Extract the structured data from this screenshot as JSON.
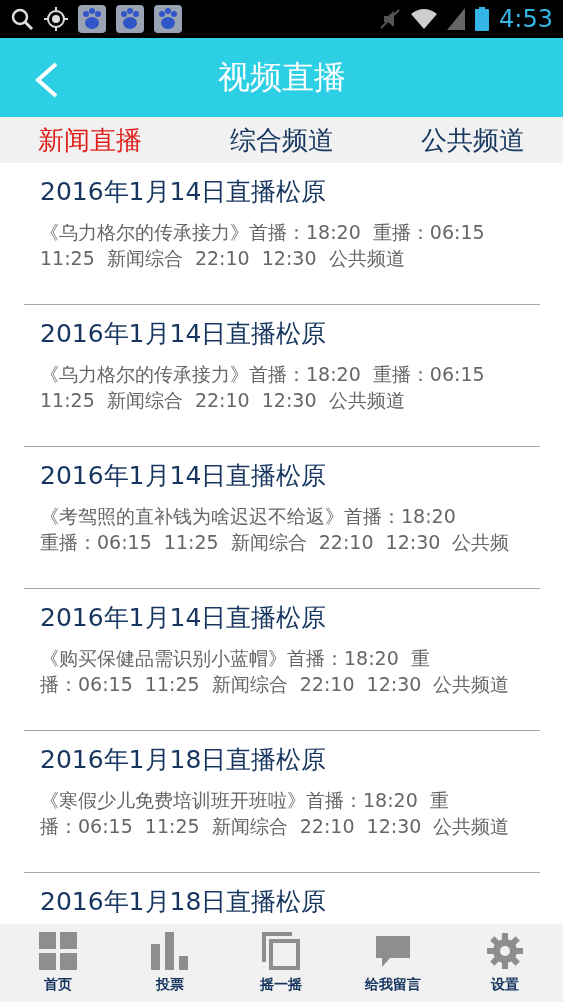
{
  "status_bar": {
    "time": "4:53"
  },
  "header": {
    "title": "视频直播"
  },
  "tabs": [
    {
      "label": "新闻直播",
      "selected": true
    },
    {
      "label": "综合频道",
      "selected": false
    },
    {
      "label": "公共频道",
      "selected": false
    }
  ],
  "items": [
    {
      "title": "2016年1月14日直播松原",
      "lines": [
        "《乌力格尔的传承接力》首播：18:20  重播：06:15",
        "11:25  新闻综合  22:10  12:30  公共频道"
      ]
    },
    {
      "title": "2016年1月14日直播松原",
      "lines": [
        "《乌力格尔的传承接力》首播：18:20  重播：06:15",
        "11:25  新闻综合  22:10  12:30  公共频道"
      ]
    },
    {
      "title": "2016年1月14日直播松原",
      "lines": [
        "《考驾照的直补钱为啥迟迟不给返》首播：18:20",
        "重播：06:15  11:25  新闻综合  22:10  12:30  公共频"
      ]
    },
    {
      "title": "2016年1月14日直播松原",
      "lines": [
        "《购买保健品需识别小蓝帽》首播：18:20  重",
        "播：06:15  11:25  新闻综合  22:10  12:30  公共频道"
      ]
    },
    {
      "title": "2016年1月18日直播松原",
      "lines": [
        "《寒假少儿免费培训班开班啦》首播：18:20  重",
        "播：06:15  11:25  新闻综合  22:10  12:30  公共频道"
      ]
    },
    {
      "title": "2016年1月18日直播松原"
    }
  ],
  "bottom_nav": [
    {
      "kind": "grid",
      "label": "首页"
    },
    {
      "kind": "bars",
      "label": "投票"
    },
    {
      "kind": "squares",
      "label": "摇一摇"
    },
    {
      "kind": "chat",
      "label": "给我留言"
    },
    {
      "kind": "gear",
      "label": "设置"
    }
  ]
}
